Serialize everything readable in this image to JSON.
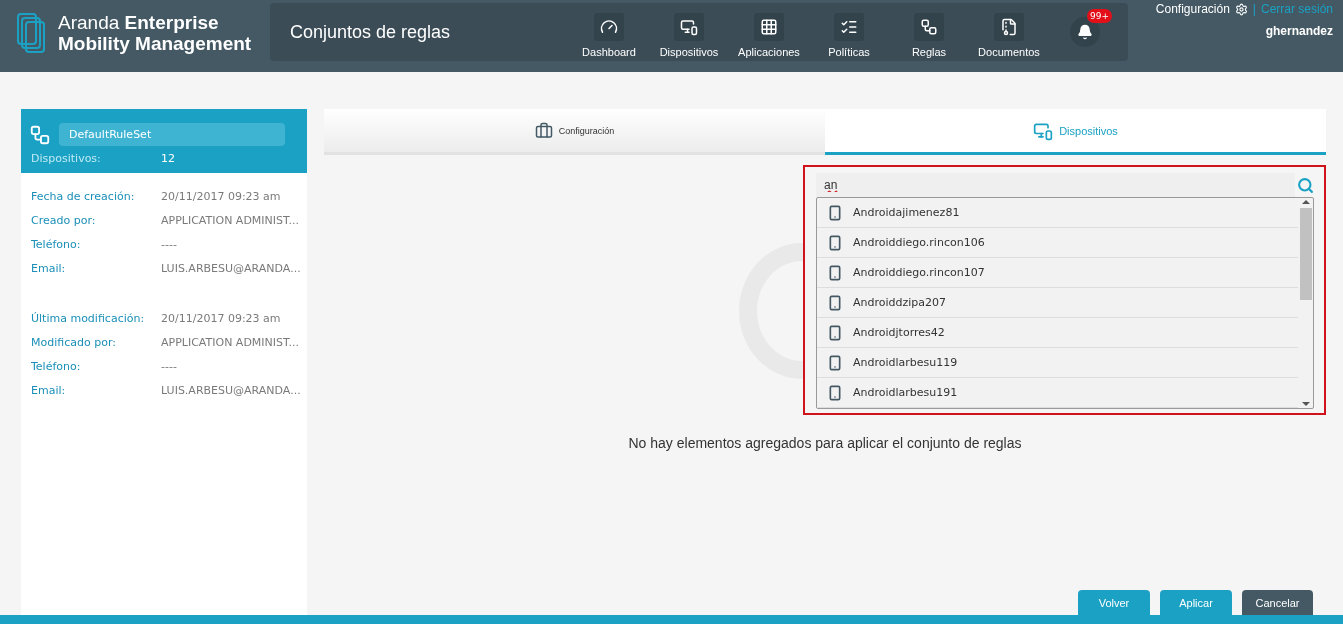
{
  "header": {
    "brand_light": "Aranda",
    "brand_bold": "Enterprise",
    "brand_line2": "Mobility Management",
    "page_title": "Conjuntos de reglas",
    "nav": [
      {
        "kind": "dashboard",
        "label": "Dashboard"
      },
      {
        "kind": "devices",
        "label": "Dispositivos"
      },
      {
        "kind": "apps",
        "label": "Aplicaciones"
      },
      {
        "kind": "policies",
        "label": "Políticas"
      },
      {
        "kind": "rules",
        "label": "Reglas"
      },
      {
        "kind": "documents",
        "label": "Documentos"
      }
    ],
    "notifications": "99+",
    "config_link": "Configuración",
    "separator": "|",
    "logout_link": "Cerrar sesión",
    "user": "ghernandez"
  },
  "ruleset": {
    "name": "DefaultRuleSet",
    "devices_label": "Dispositivos:",
    "devices_count": "12",
    "created": [
      {
        "label": "Fecha de creación:",
        "value": "20/11/2017 09:23 am"
      },
      {
        "label": "Creado por:",
        "value": "APPLICATION ADMINIST..."
      },
      {
        "label": "Teléfono:",
        "value": "----"
      },
      {
        "label": "Email:",
        "value": "LUIS.ARBESU@ARANDA..."
      }
    ],
    "modified": [
      {
        "label": "Última modificación:",
        "value": "20/11/2017 09:23 am"
      },
      {
        "label": "Modificado por:",
        "value": "APPLICATION ADMINIST..."
      },
      {
        "label": "Teléfono:",
        "value": "----"
      },
      {
        "label": "Email:",
        "value": "LUIS.ARBESU@ARANDA..."
      }
    ]
  },
  "tabs": [
    {
      "kind": "config",
      "label": "Configuración",
      "selected": false
    },
    {
      "kind": "devices",
      "label": "Dispositivos",
      "selected": true
    }
  ],
  "search": {
    "value": "an"
  },
  "results": [
    "Androidajimenez81",
    "Androiddiego.rincon106",
    "Androiddiego.rincon107",
    "Androiddzipa207",
    "Androidjtorres42",
    "Androidlarbesu119",
    "Androidlarbesu191"
  ],
  "empty_message": "No hay elementos agregados para aplicar el conjunto de reglas",
  "buttons": [
    {
      "kind": "primary",
      "label": "Volver"
    },
    {
      "kind": "primary",
      "label": "Aplicar"
    },
    {
      "kind": "secondary",
      "label": "Cancelar"
    }
  ]
}
